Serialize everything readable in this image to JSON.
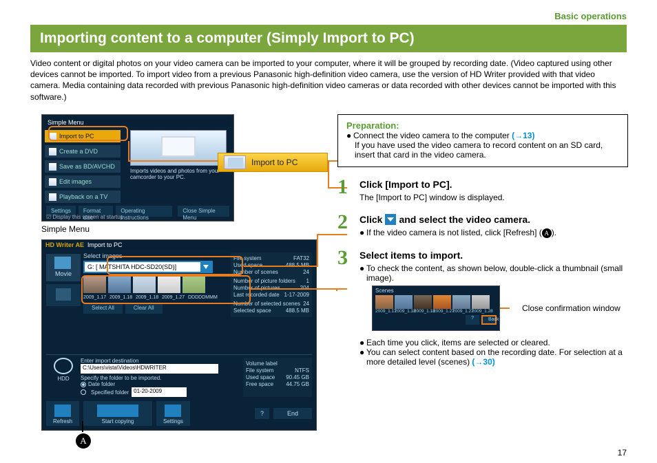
{
  "breadcrumb": "Basic operations",
  "page_title": "Importing content to a computer (Simply Import to PC)",
  "intro_text": "Video content or digital photos on your video camera can be imported to your computer, where it will be grouped by recording date. (Video captured using other devices cannot be imported. To import video from a previous Panasonic high-definition video camera, use the version of HD Writer provided with that video camera. Media containing data recorded with previous Panasonic high-definition video cameras or data recorded with other devices cannot be imported with this software.)",
  "simple_menu": {
    "title": "Simple Menu",
    "caption": "Simple Menu",
    "items": [
      "Import to PC",
      "Create a DVD",
      "Save as BD/AVCHD",
      "Edit images",
      "Playback on a TV"
    ],
    "desc": "Imports videos and photos from your camcorder to your PC.",
    "bottom_buttons": [
      "Settings",
      "Format disc",
      "Operating instructions"
    ],
    "close_btn": "Close Simple Menu",
    "checkbox": "Display this screen at startup"
  },
  "callout_button": "Import to PC",
  "import_window": {
    "app": "HD Writer AE",
    "title": "Import to PC",
    "left_tabs": {
      "movie": "Movie"
    },
    "select_images_label": "Select images",
    "dropdown_value": "G: [ MATSHITA HDC-SD20(SD)]",
    "thumb_dates": [
      "2009_1.17",
      "2009_1.18",
      "2009_1.18",
      "2009_1.27",
      "DDDDDMMM"
    ],
    "info": {
      "File system": "FAT32",
      "Used space": "488.5 MB",
      "Number of scenes": "24",
      "Number of picture folders": "1",
      "Number of pictures": "204",
      "Last recorded date": "1-17-2009",
      "Number of selected scenes": "24",
      "Selected space": "488.5 MB"
    },
    "btn_select_all": "Select All",
    "btn_clear_all": "Clear All",
    "dest": {
      "hdd_label": "HDD",
      "enter_label": "Enter import destination",
      "path": "C:\\Users\\vista\\Videos\\HDWRITER",
      "specify": "Specify the folder to be imported.",
      "date_folder": "Date folder",
      "spec_folder": "Specified folder",
      "date_value": "01-20-2009",
      "info": {
        "Volume label": "",
        "File system": "NTFS",
        "Used space": "90.45 GB",
        "Free space": "44.75 GB"
      }
    },
    "big_buttons": {
      "refresh": "Refresh",
      "start": "Start copying",
      "settings": "Settings"
    },
    "end": "End"
  },
  "marker_A": "A",
  "prep": {
    "title": "Preparation:",
    "line1a": "Connect the video camera to the computer ",
    "line1b": "(→13)",
    "line2": "If you have used the video camera to record content on an SD card, insert that card in the video camera."
  },
  "steps": [
    {
      "num": "1",
      "head": "Click [Import to PC].",
      "sub": "The [Import to PC] window is displayed."
    },
    {
      "num": "2",
      "head_a": "Click ",
      "head_b": " and select the video camera.",
      "bullet_a": "If the video camera is not listed, click [Refresh] (",
      "bullet_b": ")."
    },
    {
      "num": "3",
      "head": "Select items to import.",
      "bullet1": "To check the content, as shown below, double-click a thumbnail (small image).",
      "scenes_win_title": "Scenes",
      "scenes_dates": [
        "2009_1.17",
        "2009_1.18",
        "2009_1.18",
        "2009_1.27",
        "2009_1.27",
        "2009_1.28"
      ],
      "scenes_btn_back": "Back",
      "scenes_close_hint": "Close confirmation window",
      "bullet2": "Each time you click, items are selected or cleared.",
      "bullet3a": "You can select content based on the recording date. For selection at a more detailed level (scenes) ",
      "bullet3b": "(→30)"
    }
  ],
  "page_number": "17"
}
